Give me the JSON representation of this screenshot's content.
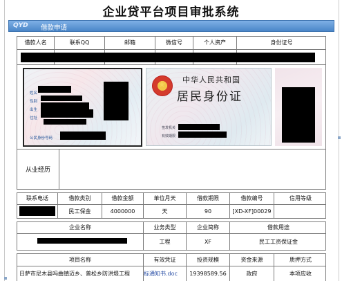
{
  "window": {
    "title": "企业贷平台项目审批系统"
  },
  "panel": {
    "code": "QYD",
    "title": "借款申请"
  },
  "borrower_table": {
    "headers": [
      "借款人名",
      "联系QQ",
      "邮箱",
      "微信号",
      "个人资产",
      "身份证号"
    ]
  },
  "id_card": {
    "country": "中华人民共和国",
    "card_title": "居民身份证",
    "back_labels": [
      "签发机关",
      "有效期限"
    ],
    "front_labels": [
      "姓名",
      "性别",
      "出生",
      "住址",
      "公民身份号码"
    ]
  },
  "experience": {
    "label": "从业经历"
  },
  "loan_table": {
    "headers": [
      "联系电话",
      "借款类别",
      "借款金额",
      "单位月天",
      "借款期限",
      "借款编号",
      "信用等级"
    ],
    "row": {
      "category": "民工保金",
      "amount": "4000000",
      "unit": "天",
      "term": "90",
      "number": "[XD-XF]00029",
      "credit": ""
    }
  },
  "company_table": {
    "headers": [
      "企业名称",
      "业务类型",
      "企业简称",
      "借款用途"
    ],
    "row": {
      "business_type": "工程",
      "short_name": "XF",
      "purpose": "民工工资保证金"
    }
  },
  "project_table": {
    "headers": [
      "项目名称",
      "有效凭证",
      "投资规模",
      "资金来源",
      "质押方式"
    ],
    "row": {
      "name": "日萨市尼木县吗曲镇迈乡、普松乡防洪堤工程",
      "voucher": "标通知书.doc",
      "scale": "19398589.56",
      "source": "政府",
      "pledge": "本项应收"
    }
  }
}
